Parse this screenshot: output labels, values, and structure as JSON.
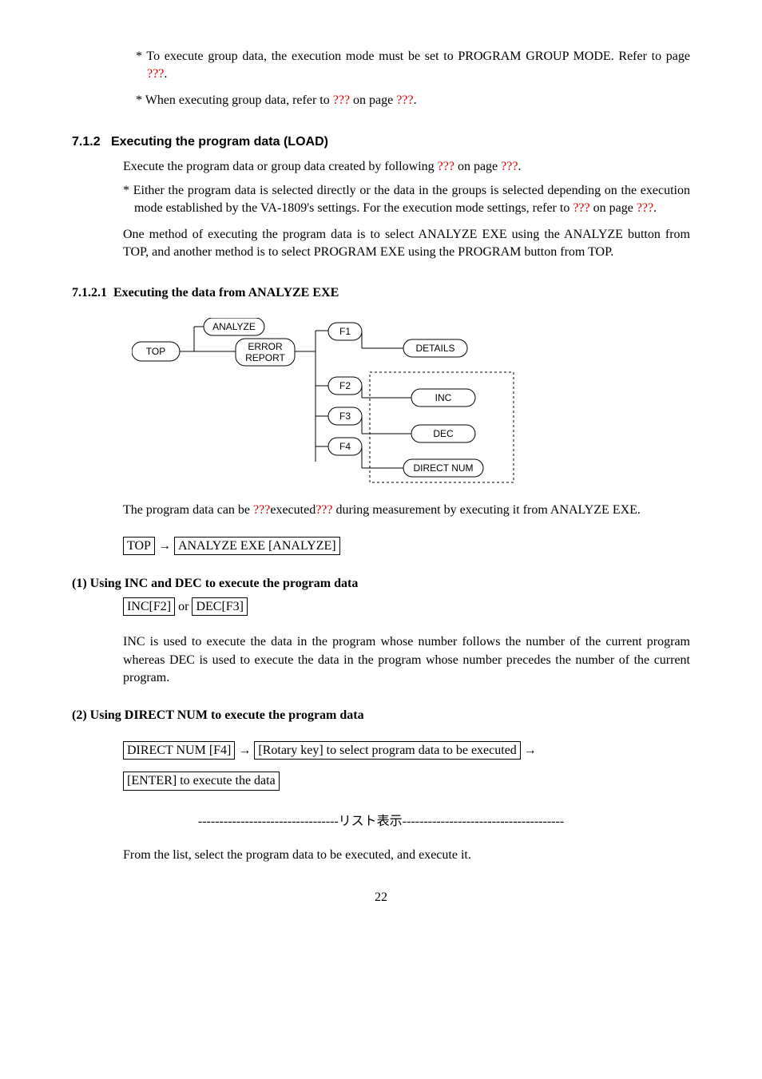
{
  "p1a": "To execute group data, the execution mode must be set to PROGRAM GROUP MODE.    Refer to page ",
  "p1b": ".",
  "p2a": "When executing group data, refer to ",
  "p2b": " on page ",
  "p2c": ".",
  "qmarks": "???",
  "sec_num": "7.1.2",
  "sec_title": "Executing the program data (LOAD)",
  "p3a": "Execute the program data or group data created by following ",
  "p3b": " on page ",
  "p3c": ".",
  "p4a": "Either the program data is selected directly or the data in the groups is selected depending on the execution mode established by the VA-1809's settings.    For the execution mode settings, refer to ",
  "p4b": " on page ",
  "p4c": ".",
  "p5": "One method of executing the program data is to select ANALYZE EXE using the ANALYZE button from TOP, and another method is to select PROGRAM EXE using the PROGRAM button from TOP.",
  "sub_num": "7.1.2.1",
  "sub_title": "Executing the data from ANALYZE EXE",
  "dg": {
    "top": "TOP",
    "analyze": "ANALYZE",
    "error1": "ERROR",
    "error2": "REPORT",
    "f1": "F1",
    "f2": "F2",
    "f3": "F3",
    "f4": "F4",
    "details": "DETAILS",
    "inc": "INC",
    "dec": "DEC",
    "direct": "DIRECT NUM"
  },
  "p6a": "The program data can be ",
  "p6b": "executed",
  "p6c": " during measurement by executing it from ANALYZE EXE.",
  "nav1a": "TOP",
  "nav1b": "ANALYZE EXE [ANALYZE]",
  "arrow": "→",
  "h1": "(1)  Using INC and DEC to execute the program data",
  "nav2a": "INC[F2]",
  "nav2or": " or ",
  "nav2b": "DEC[F3]",
  "p7": "INC is used to execute the data in the program whose number follows the number of the current program whereas DEC is used to execute the data in the program whose number precedes the number of the current program.",
  "h2": "(2)  Using DIRECT NUM to execute the program data",
  "nav3a": "DIRECT NUM [F4]",
  "nav3b": "[Rotary key] to select program data to be executed",
  "nav3c": "[ENTER] to execute the data",
  "listline": "---------------------------------リスト表示--------------------------------------",
  "p8": "From the list, select the program data to be executed, and execute it.",
  "page": "22"
}
